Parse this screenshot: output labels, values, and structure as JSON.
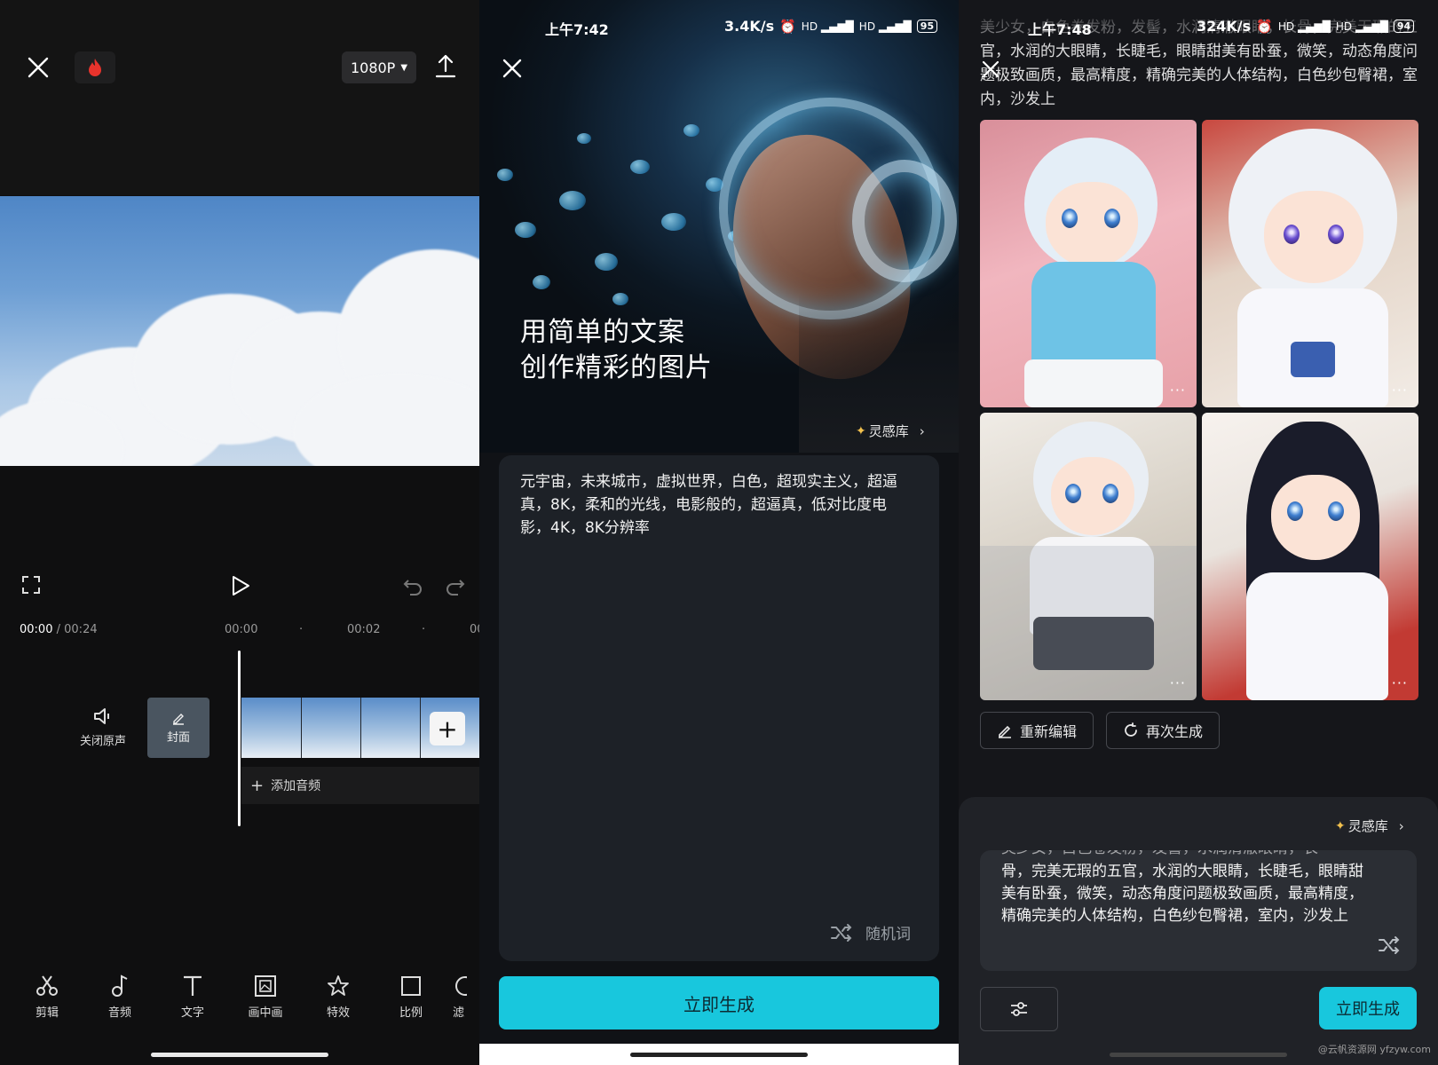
{
  "editor": {
    "resolution": "1080P",
    "time_current": "00:00",
    "time_separator": "/",
    "time_total": "00:24",
    "ruler": [
      "00:00",
      "00:02",
      "00"
    ],
    "mute_label": "关闭原声",
    "cover_label": "封面",
    "add_audio_label": "添加音频",
    "tools": [
      {
        "label": "剪辑",
        "icon": "scissors-icon"
      },
      {
        "label": "音频",
        "icon": "music-note-icon"
      },
      {
        "label": "文字",
        "icon": "text-icon"
      },
      {
        "label": "画中画",
        "icon": "picture-in-picture-icon"
      },
      {
        "label": "特效",
        "icon": "effects-star-icon"
      },
      {
        "label": "比例",
        "icon": "ratio-square-icon"
      },
      {
        "label": "滤",
        "icon": "filter-icon"
      }
    ]
  },
  "creator": {
    "status_time": "上午7:42",
    "status_speed": "3.4K/s",
    "battery": "95",
    "hero_title_line1": "用简单的文案",
    "hero_title_line2": "创作精彩的图片",
    "inspiration_label": "灵感库",
    "prompt": "元宇宙，未来城市，虚拟世界，白色，超现实主义，超逼真，8K，柔和的光线，电影般的，超逼真，低对比度电影，4K，8K分辨率",
    "random_label": "随机词",
    "generate_label": "立即生成"
  },
  "results": {
    "status_time": "上午7:48",
    "status_speed": "324K/s",
    "battery": "94",
    "prompt_top": "美少女，白色卷发粉，发髻，水润清澈眼睛，长骨，完美无瑕的五官，水润的大眼睛，长睫毛，眼睛甜美有卧蚕，微笑，动态角度问题极致画质，最高精度，精确完美的人体结构，白色纱包臀裙，室内，沙发上",
    "more_label": "···",
    "reedit_label": "重新编辑",
    "regenerate_label": "再次生成",
    "inspiration_label": "灵感库",
    "prompt_box_line0": "美少女，白色卷发粉，发髻，水润清澈眼睛，长",
    "prompt_box": "骨，完美无瑕的五官，水润的大眼睛，长睫毛，眼睛甜美有卧蚕，微笑，动态角度问题极致画质，最高精度，精确完美的人体结构，白色纱包臀裙，室内，沙发上",
    "generate_label": "立即生成",
    "watermark": "@云帆资源网 yfzyw.com"
  },
  "colors": {
    "accent_cyan": "#18c7dd",
    "fire_red": "#e8332c",
    "panel_dark": "#0f0f10"
  }
}
